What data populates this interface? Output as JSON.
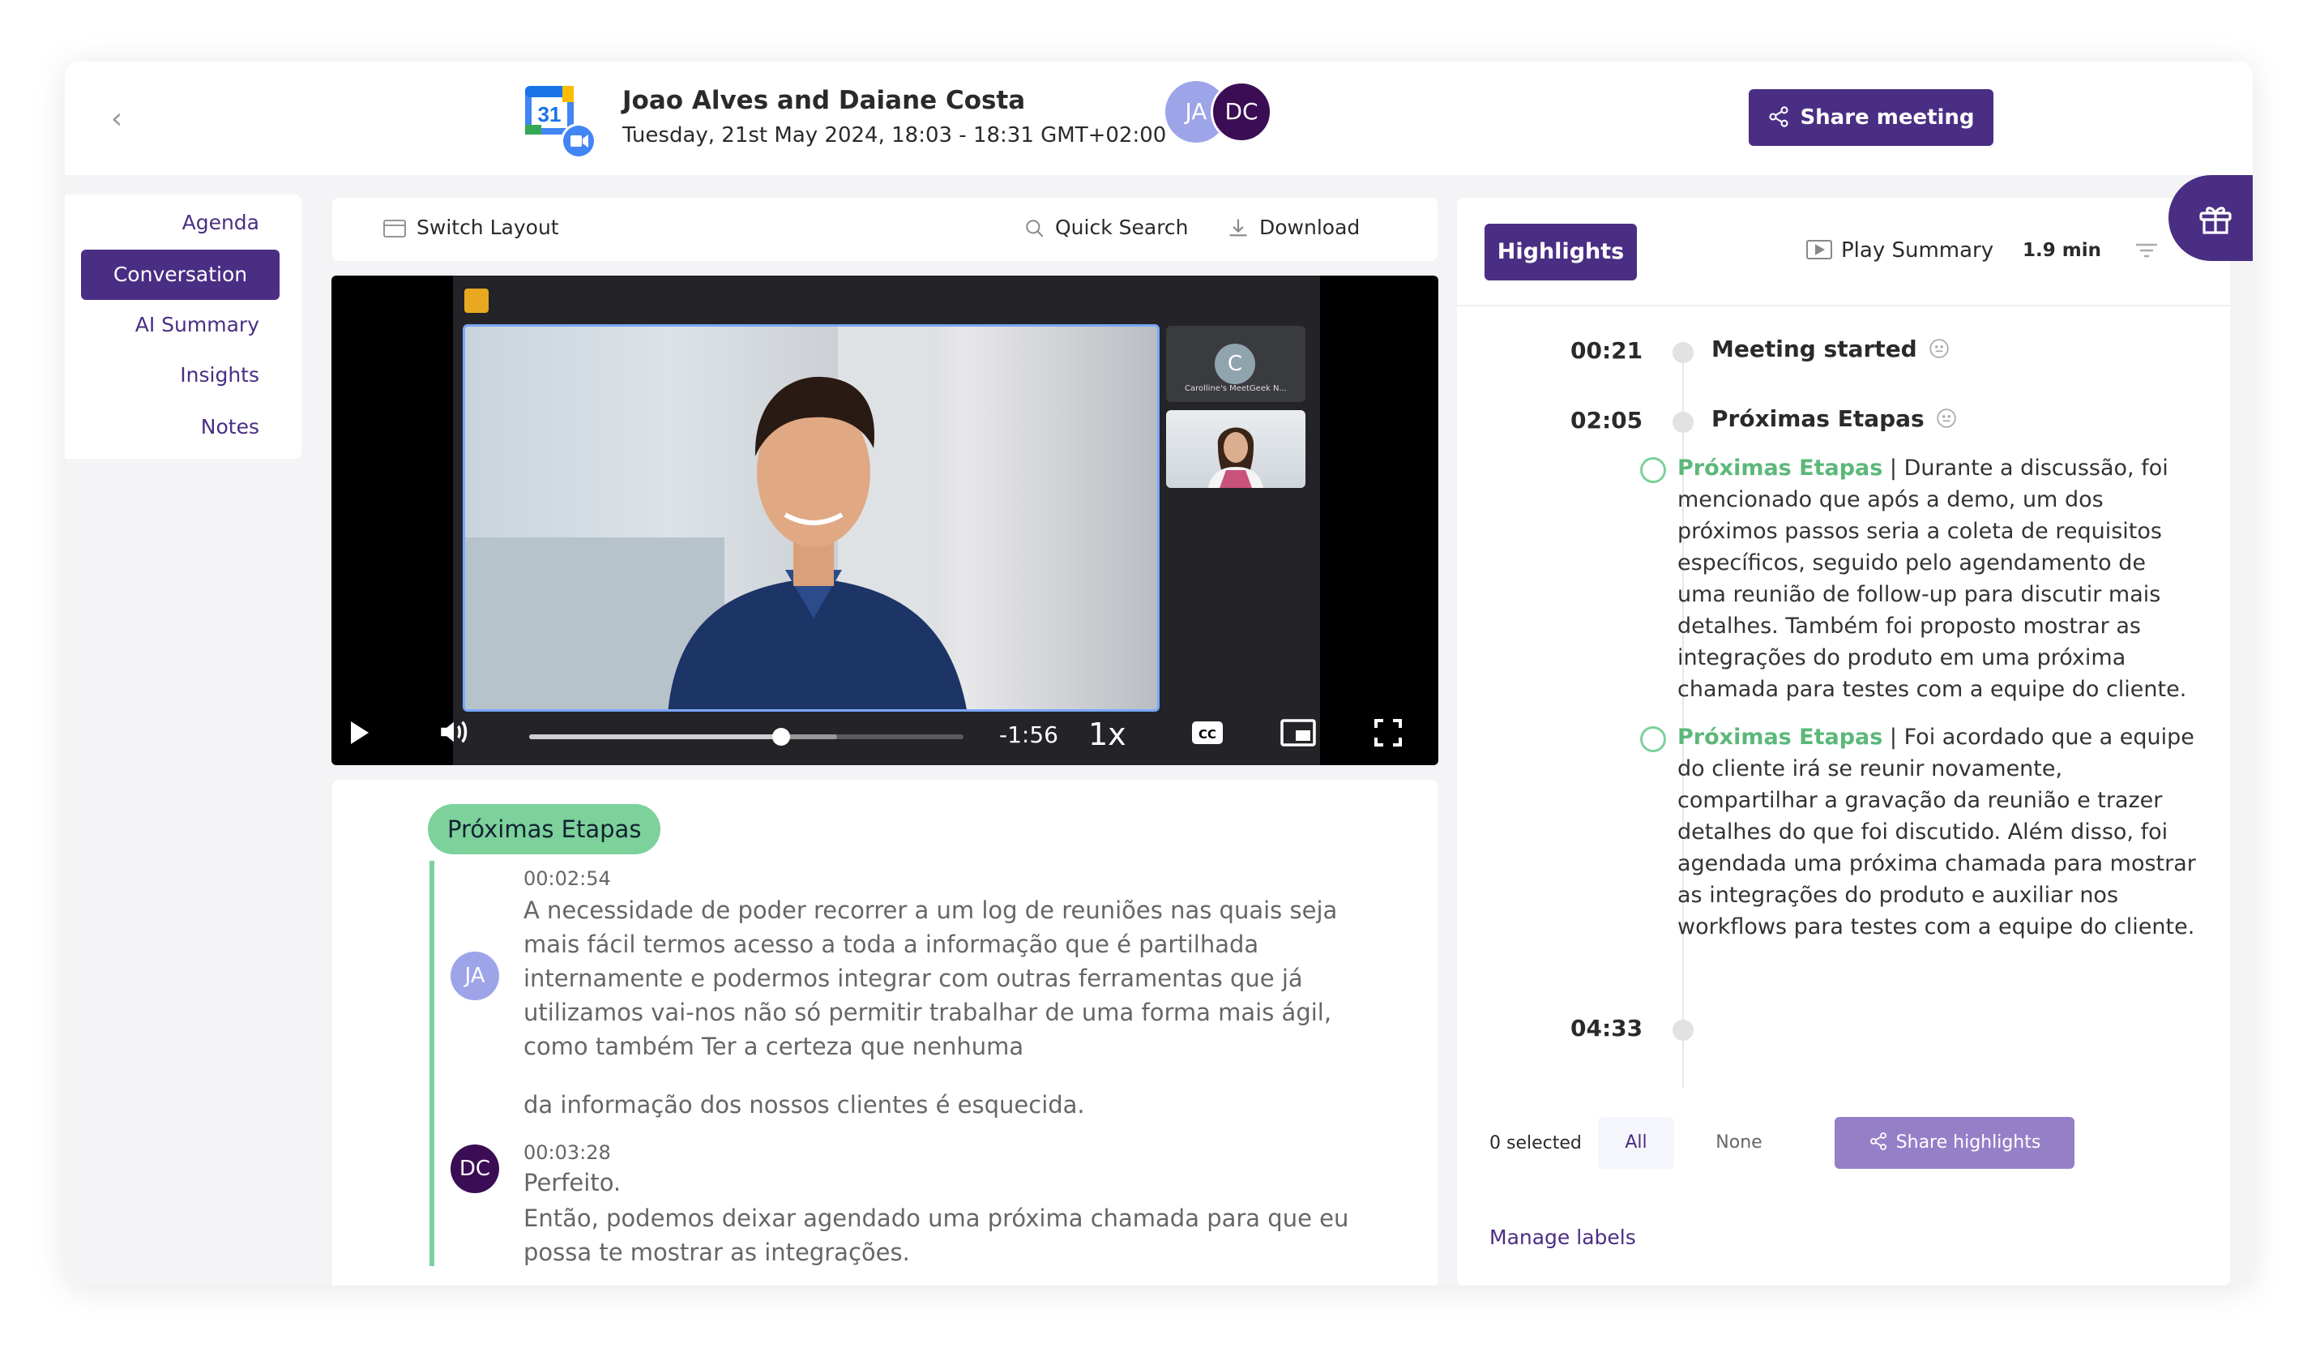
{
  "header": {
    "title": "Joao Alves and Daiane Costa",
    "subtitle": "Tuesday, 21st May 2024, 18:03 - 18:31 GMT+02:00",
    "calendar_day": "31",
    "avatars": [
      "JA",
      "DC"
    ],
    "share_label": "Share meeting"
  },
  "sidebar": {
    "items": [
      {
        "label": "Agenda"
      },
      {
        "label": "Conversation",
        "active": true
      },
      {
        "label": "AI Summary"
      },
      {
        "label": "Insights"
      },
      {
        "label": "Notes"
      }
    ]
  },
  "toolbar": {
    "switch_layout": "Switch Layout",
    "quick_search": "Quick Search",
    "download": "Download"
  },
  "video": {
    "participant_initial": "C",
    "participant_name": "Carolline's MeetGeek N...",
    "time_remaining": "-1:56",
    "speed": "1x",
    "progress_fraction": 0.58
  },
  "transcript": {
    "topic": "Próximas Etapas",
    "entries": [
      {
        "speaker": "JA",
        "time": "00:02:54",
        "text": "A necessidade de poder recorrer a um log de reuniões nas quais seja mais fácil termos acesso a toda a informação que é partilhada internamente e podermos integrar com outras ferramentas que já utilizamos vai-nos não só permitir trabalhar de uma forma mais ágil, como também Ter a certeza que nenhuma",
        "text2": "da informação dos nossos clientes é esquecida."
      },
      {
        "speaker": "DC",
        "time": "00:03:28",
        "text": "Perfeito.",
        "text2": "Então, podemos deixar agendado uma próxima chamada para que eu possa te mostrar as integrações."
      }
    ]
  },
  "highlights": {
    "tab_label": "Highlights",
    "play_summary": "Play Summary",
    "duration": "1.9 min",
    "timeline": [
      {
        "time": "00:21",
        "title": "Meeting started"
      },
      {
        "time": "02:05",
        "title": "Próximas Etapas"
      },
      {
        "time": "04:33",
        "title": ""
      }
    ],
    "items": [
      {
        "label": "Próximas Etapas",
        "text": " | Durante a discussão, foi mencionado que após a demo, um dos próximos passos seria a coleta de requisitos específicos, seguido pelo agendamento de uma reunião de follow-up para discutir mais detalhes. Também foi proposto mostrar as integrações do produto em uma próxima chamada para testes com a equipe do cliente."
      },
      {
        "label": "Próximas Etapas",
        "text": " | Foi acordado que a equipe do cliente irá se reunir novamente, compartilhar a gravação da reunião e trazer detalhes do que foi discutido. Além disso, foi agendada uma próxima chamada para mostrar as integrações do produto e auxiliar nos workflows para testes com a equipe do cliente."
      }
    ],
    "selected": "0 selected",
    "all": "All",
    "none": "None",
    "share_highlights": "Share highlights",
    "manage_labels": "Manage labels"
  },
  "colors": {
    "brand": "#4a2e84",
    "accent_green": "#7dd19a",
    "avatar_ja": "#9ea4e8",
    "avatar_dc": "#3b0d54"
  },
  "icons": [
    "back-chevron-icon",
    "google-calendar-icon",
    "meet-camera-icon",
    "share-icon",
    "switch-layout-icon",
    "search-icon",
    "download-icon",
    "play-icon",
    "volume-icon",
    "cc-icon",
    "pip-icon",
    "fullscreen-icon",
    "video-play-icon",
    "filter-icon",
    "gift-icon",
    "emoji-icon"
  ]
}
